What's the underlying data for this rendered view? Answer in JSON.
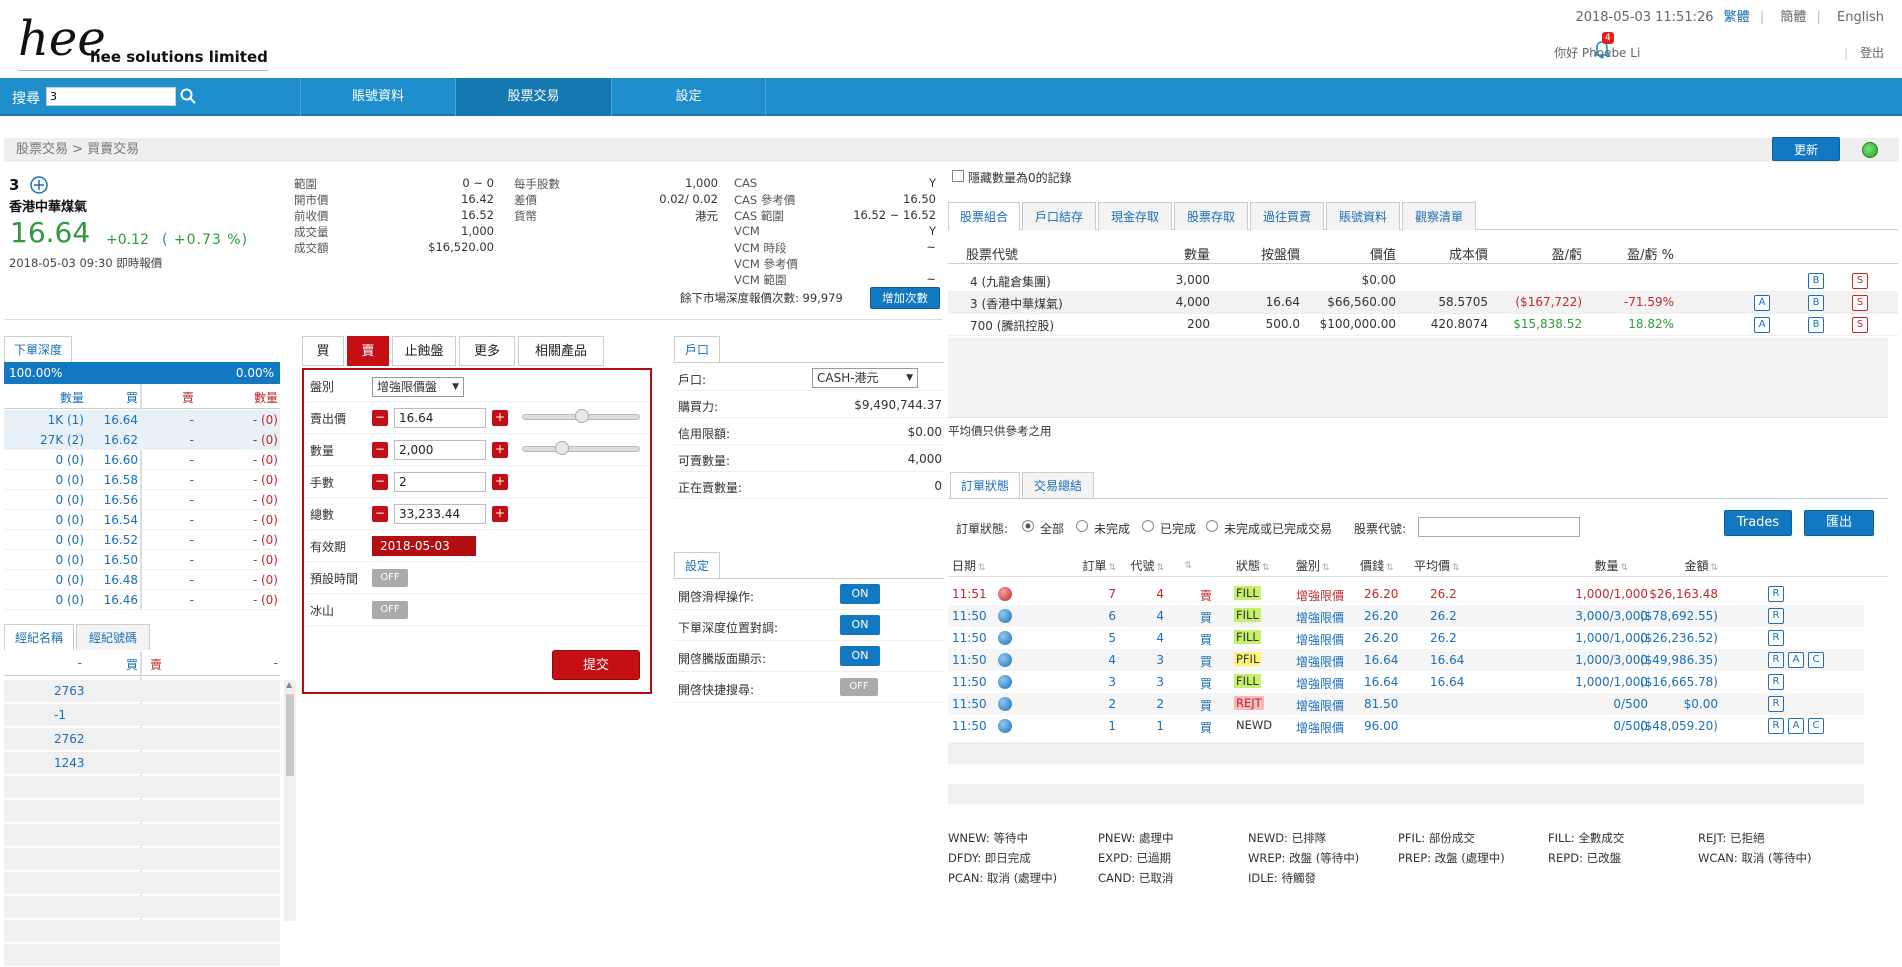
{
  "header": {
    "datetime": "2018-05-03 11:51:26",
    "lang_trad": "繁體",
    "lang_simp": "簡體",
    "lang_en": "English",
    "sep": "|",
    "notif_count": "4",
    "greeting": "你好 Phoebe Li",
    "logout": "登出",
    "company": "hee solutions limited",
    "logo_text": "hee"
  },
  "nav": {
    "search_label": "搜尋",
    "search_value": "3",
    "tabs": [
      "賬號資料",
      "股票交易",
      "設定"
    ]
  },
  "breadcrumb": "股票交易 > 買賣交易",
  "update_button": "更新",
  "quote": {
    "code": "3",
    "name": "香港中華煤氣",
    "price": "16.64",
    "change": "+0.12",
    "change_pct": "( +0.73 %)",
    "timestamp": "2018-05-03 09:30 即時報價",
    "col1": [
      {
        "label": "範圍",
        "value": "0 ~ 0"
      },
      {
        "label": "開市價",
        "value": "16.42"
      },
      {
        "label": "前收價",
        "value": "16.52"
      },
      {
        "label": "成交量",
        "value": "1,000"
      },
      {
        "label": "成交額",
        "value": "$16,520.00"
      }
    ],
    "col2": [
      {
        "label": "每手股數",
        "value": "1,000"
      },
      {
        "label": "差價",
        "value": "0.02/ 0.02"
      },
      {
        "label": "貨幣",
        "value": "港元"
      }
    ],
    "col3": [
      {
        "label": "CAS",
        "value": "Y"
      },
      {
        "label": "CAS 參考價",
        "value": "16.50"
      },
      {
        "label": "CAS 範圍",
        "value": "16.52 ~ 16.52"
      },
      {
        "label": "VCM",
        "value": "Y"
      },
      {
        "label": "VCM 時段",
        "value": "~"
      },
      {
        "label": "VCM 參考價",
        "value": ""
      },
      {
        "label": "VCM 範圍",
        "value": "~"
      }
    ],
    "depth_remaining": "餘下市場深度報價次數: 99,979",
    "add_count_button": "增加次數"
  },
  "depth": {
    "tab": "下單深度",
    "bid_pct": "100.00%",
    "ask_pct": "0.00%",
    "h_qty": "數量",
    "h_buy": "買",
    "h_sell": "賣",
    "h_qty2": "數量",
    "rows": [
      [
        "1K (1)",
        "16.64",
        "-",
        "- (0)"
      ],
      [
        "27K (2)",
        "16.62",
        "-",
        "- (0)"
      ],
      [
        "0 (0)",
        "16.60",
        "-",
        "- (0)"
      ],
      [
        "0 (0)",
        "16.58",
        "-",
        "- (0)"
      ],
      [
        "0 (0)",
        "16.56",
        "-",
        "- (0)"
      ],
      [
        "0 (0)",
        "16.54",
        "-",
        "- (0)"
      ],
      [
        "0 (0)",
        "16.52",
        "-",
        "- (0)"
      ],
      [
        "0 (0)",
        "16.50",
        "-",
        "- (0)"
      ],
      [
        "0 (0)",
        "16.48",
        "-",
        "- (0)"
      ],
      [
        "0 (0)",
        "16.46",
        "-",
        "- (0)"
      ]
    ]
  },
  "broker": {
    "tabs": [
      "經紀名稱",
      "經紀號碼"
    ],
    "h_dash": "-",
    "h_buy": "買",
    "h_sell": "賣",
    "h_dash2": "-",
    "rows": [
      "2763",
      "-1",
      "2762",
      "1243"
    ]
  },
  "order": {
    "tabs": [
      "買",
      "賣",
      "止蝕盤",
      "更多",
      "相關產品"
    ],
    "type_label": "盤別",
    "type_value": "增強限價盤",
    "price_label": "賣出價",
    "price_value": "16.64",
    "qty_label": "數量",
    "qty_value": "2,000",
    "lots_label": "手數",
    "lots_value": "2",
    "total_label": "總數",
    "total_value": "33,233.44",
    "expiry_label": "有效期",
    "expiry_value": "2018-05-03",
    "preset_label": "預設時間",
    "iceberg_label": "冰山",
    "off": "OFF",
    "submit": "提交"
  },
  "account": {
    "tab": "戶口",
    "acct_label": "戶口:",
    "acct_value": "CASH-港元",
    "rows": [
      {
        "label": "購買力:",
        "value": "$9,490,744.37"
      },
      {
        "label": "信用限額:",
        "value": "$0.00"
      },
      {
        "label": "可賣數量:",
        "value": "4,000"
      },
      {
        "label": "正在賣數量:",
        "value": "0"
      }
    ]
  },
  "settings": {
    "tab": "設定",
    "rows": [
      {
        "label": "開啓滑桿操作:",
        "value": "ON"
      },
      {
        "label": "下單深度位置對調:",
        "value": "ON"
      },
      {
        "label": "開啓騰版面顯示:",
        "value": "ON"
      },
      {
        "label": "開啓快捷搜尋:",
        "value": "OFF"
      }
    ]
  },
  "portfolio": {
    "hide_zero": "隱藏數量為0的記錄",
    "tabs": [
      "股票組合",
      "戶口結存",
      "現金存取",
      "股票存取",
      "過往買賣",
      "賬號資料",
      "觀察清單"
    ],
    "headers": [
      "股票代號",
      "數量",
      "按盤價",
      "價值",
      "成本價",
      "盈/虧",
      "盈/虧 %"
    ],
    "rows": [
      [
        "4 (九龍倉集團)",
        "3,000",
        "",
        "$0.00",
        "",
        "",
        ""
      ],
      [
        "3 (香港中華煤氣)",
        "4,000",
        "16.64",
        "$66,560.00",
        "58.5705",
        "($167,722)",
        "-71.59%"
      ],
      [
        "700 (騰訊控股)",
        "200",
        "500.0",
        "$100,000.00",
        "420.8074",
        "$15,838.52",
        "18.82%"
      ]
    ],
    "note": "平均價只供參考之用",
    "btn_a": "A",
    "btn_b": "B",
    "btn_s": "S"
  },
  "orders": {
    "tabs": [
      "訂單狀態",
      "交易總結"
    ],
    "status_label": "訂單狀態:",
    "filters": [
      "全部",
      "未完成",
      "已完成",
      "未完成或已完成交易"
    ],
    "stock_code_label": "股票代號:",
    "trades_button": "Trades",
    "export_button": "匯出",
    "headers": [
      "日期",
      "訂單",
      "代號",
      "",
      "狀態",
      "盤別",
      "價錢",
      "平均價",
      "數量",
      "金額"
    ],
    "rows": [
      {
        "time": "11:51",
        "order": "7",
        "code": "4",
        "side": "賣",
        "status": "FILL",
        "type": "增強限價",
        "price": "26.20",
        "avg": "26.2",
        "qty": "1,000/1,000",
        "amount": "$26,163.48",
        "btns": [
          "R"
        ]
      },
      {
        "time": "11:50",
        "order": "6",
        "code": "4",
        "side": "買",
        "status": "FILL",
        "type": "增強限價",
        "price": "26.20",
        "avg": "26.2",
        "qty": "3,000/3,000",
        "amount": "($78,692.55)",
        "btns": [
          "R"
        ]
      },
      {
        "time": "11:50",
        "order": "5",
        "code": "4",
        "side": "買",
        "status": "FILL",
        "type": "增強限價",
        "price": "26.20",
        "avg": "26.2",
        "qty": "1,000/1,000",
        "amount": "($26,236.52)",
        "btns": [
          "R"
        ]
      },
      {
        "time": "11:50",
        "order": "4",
        "code": "3",
        "side": "買",
        "status": "PFIL",
        "type": "增強限價",
        "price": "16.64",
        "avg": "16.64",
        "qty": "1,000/3,000",
        "amount": "($49,986.35)",
        "btns": [
          "R",
          "A",
          "C"
        ]
      },
      {
        "time": "11:50",
        "order": "3",
        "code": "3",
        "side": "買",
        "status": "FILL",
        "type": "增強限價",
        "price": "16.64",
        "avg": "16.64",
        "qty": "1,000/1,000",
        "amount": "($16,665.78)",
        "btns": [
          "R"
        ]
      },
      {
        "time": "11:50",
        "order": "2",
        "code": "2",
        "side": "買",
        "status": "REJT",
        "type": "增強限價",
        "price": "81.50",
        "avg": "",
        "qty": "0/500",
        "amount": "$0.00",
        "btns": [
          "R"
        ]
      },
      {
        "time": "11:50",
        "order": "1",
        "code": "1",
        "side": "買",
        "status": "NEWD",
        "type": "增強限價",
        "price": "96.00",
        "avg": "",
        "qty": "0/500",
        "amount": "($48,059.20)",
        "btns": [
          "R",
          "A",
          "C"
        ]
      }
    ]
  },
  "legend": [
    [
      "WNEW: 等待中",
      "PNEW: 處理中",
      "NEWD: 已排隊",
      "PFIL: 部份成交",
      "FILL: 全數成交",
      "REJT: 已拒絕"
    ],
    [
      "DFDY: 即日完成",
      "EXPD: 已過期",
      "WREP: 改盤 (等待中)",
      "PREP: 改盤 (處理中)",
      "REPD: 已改盤",
      "WCAN: 取消 (等待中)"
    ],
    [
      "PCAN: 取消 (處理中)",
      "CAND: 已取消",
      "IDLE: 待觸發"
    ]
  ]
}
